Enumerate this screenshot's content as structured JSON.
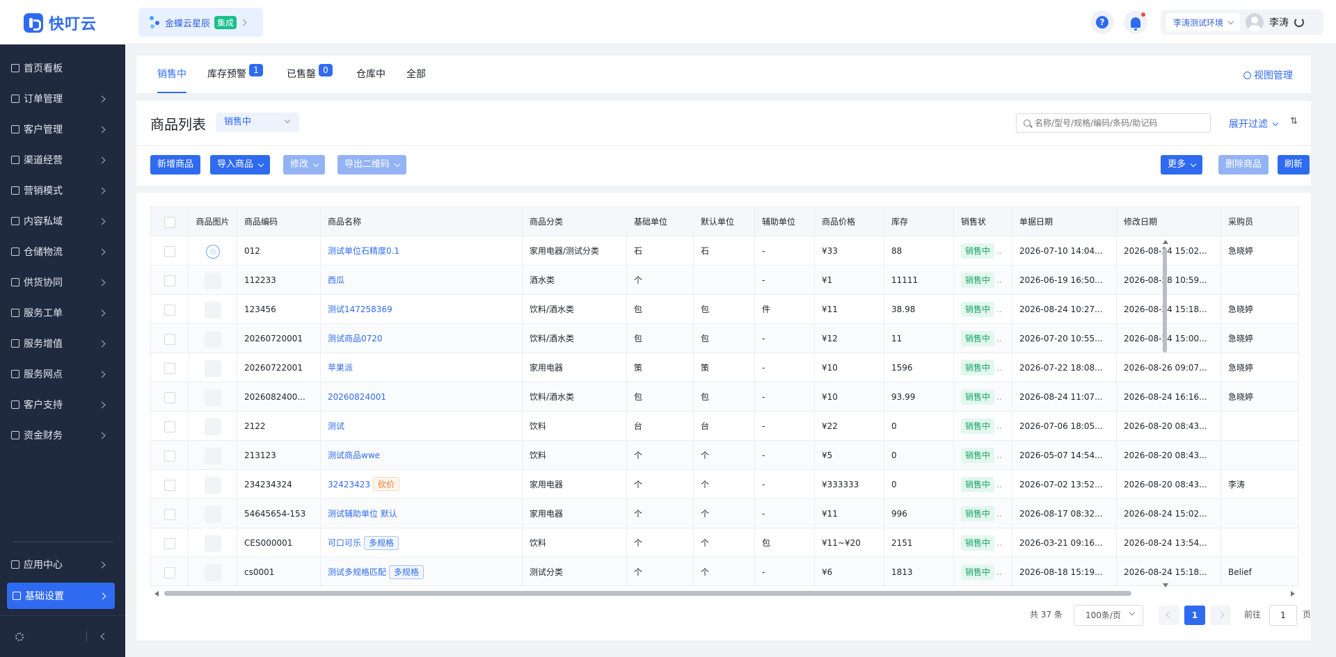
{
  "app": {
    "logo_text": "快叮云"
  },
  "header": {
    "app_switch": {
      "name": "金蝶云星辰",
      "tag": "集成"
    },
    "env": "李涛测试环境",
    "user_name": "李涛",
    "icons": [
      "help-icon",
      "bell-icon",
      "refresh-icon"
    ]
  },
  "sidebar": {
    "items": [
      {
        "label": "首页看板",
        "icon": "home-icon"
      },
      {
        "label": "订单管理",
        "icon": "order-icon"
      },
      {
        "label": "客户管理",
        "icon": "user-icon"
      },
      {
        "label": "渠道经营",
        "icon": "channel-icon"
      },
      {
        "label": "营销模式",
        "icon": "tag-icon"
      },
      {
        "label": "内容私域",
        "icon": "image-icon"
      },
      {
        "label": "仓储物流",
        "icon": "warehouse-icon"
      },
      {
        "label": "供货协同",
        "icon": "supply-icon"
      },
      {
        "label": "服务工单",
        "icon": "ticket-icon"
      },
      {
        "label": "服务增值",
        "icon": "bag-icon"
      },
      {
        "label": "服务网点",
        "icon": "store-icon"
      },
      {
        "label": "客户支持",
        "icon": "support-icon"
      },
      {
        "label": "资金财务",
        "icon": "yen-icon"
      }
    ],
    "bottom_items": [
      {
        "label": "应用中心",
        "icon": "app-icon"
      },
      {
        "label": "基础设置",
        "icon": "settings-icon",
        "active": true
      }
    ]
  },
  "tabs": [
    {
      "label": "销售中",
      "active": true
    },
    {
      "label": "库存预警",
      "badge": "1"
    },
    {
      "label": "已售罄",
      "badge": "0"
    },
    {
      "label": "仓库中"
    },
    {
      "label": "全部"
    }
  ],
  "view_manage": "视图管理",
  "list": {
    "title": "商品列表",
    "status_select": "销售中",
    "search_placeholder": "名称/型号/规格/编码/条码/助记码",
    "filter_label": "展开过滤",
    "sort_icon": "⇅"
  },
  "toolbar": {
    "add": "新增商品",
    "import": "导入商品",
    "edit": "修改",
    "export_qr": "导出二维码",
    "more": "更多",
    "delete": "删除商品",
    "refresh": "刷新"
  },
  "table": {
    "columns": [
      "商品图片",
      "商品编码",
      "商品名称",
      "商品分类",
      "基础单位",
      "默认单位",
      "辅助单位",
      "商品价格",
      "库存",
      "销售状",
      "单据日期",
      "修改日期",
      "采购员"
    ],
    "rows": [
      {
        "code": "012",
        "name": "测试单位石精度0.1",
        "tag": "",
        "category": "家用电器/测试分类",
        "base_unit": "石",
        "default_unit": "石",
        "aux_unit": "-",
        "price": "¥33",
        "stock": "88",
        "status": "销售中",
        "doc_date": "2026-07-10 14:04...",
        "mod_date": "2026-08-24 15:02...",
        "buyer": "急晓婷",
        "has_image": true
      },
      {
        "code": "112233",
        "name": "西瓜",
        "tag": "",
        "category": "酒水类",
        "base_unit": "个",
        "default_unit": "",
        "aux_unit": "-",
        "price": "¥1",
        "stock": "11111",
        "status": "销售中",
        "doc_date": "2026-06-19 16:50...",
        "mod_date": "2026-08-28 10:59...",
        "buyer": ""
      },
      {
        "code": "123456",
        "name": "测试147258369",
        "tag": "",
        "category": "饮料/酒水类",
        "base_unit": "包",
        "default_unit": "包",
        "aux_unit": "件",
        "price": "¥11",
        "stock": "38.98",
        "status": "销售中",
        "doc_date": "2026-08-24 10:27...",
        "mod_date": "2026-08-24 15:18...",
        "buyer": "急晓婷"
      },
      {
        "code": "20260720001",
        "name": "测试商品0720",
        "tag": "",
        "category": "饮料/酒水类",
        "base_unit": "包",
        "default_unit": "包",
        "aux_unit": "-",
        "price": "¥12",
        "stock": "11",
        "status": "销售中",
        "doc_date": "2026-07-20 10:55...",
        "mod_date": "2026-08-24 15:00...",
        "buyer": "急晓婷"
      },
      {
        "code": "20260722001",
        "name": "苹果派",
        "tag": "",
        "category": "家用电器",
        "base_unit": "策",
        "default_unit": "策",
        "aux_unit": "-",
        "price": "¥10",
        "stock": "1596",
        "status": "销售中",
        "doc_date": "2026-07-22 18:08...",
        "mod_date": "2026-08-26 09:07...",
        "buyer": "急晓婷"
      },
      {
        "code": "2026082400...",
        "name": "20260824001",
        "tag": "",
        "category": "饮料/酒水类",
        "base_unit": "包",
        "default_unit": "包",
        "aux_unit": "-",
        "price": "¥10",
        "stock": "93.99",
        "status": "销售中",
        "doc_date": "2026-08-24 11:07...",
        "mod_date": "2026-08-24 16:16...",
        "buyer": "急晓婷"
      },
      {
        "code": "2122",
        "name": "测试",
        "tag": "",
        "category": "饮料",
        "base_unit": "台",
        "default_unit": "台",
        "aux_unit": "-",
        "price": "¥22",
        "stock": "0",
        "status": "销售中",
        "doc_date": "2026-07-06 18:05...",
        "mod_date": "2026-08-20 08:43...",
        "buyer": ""
      },
      {
        "code": "213123",
        "name": "测试商品wwe",
        "tag": "",
        "category": "饮料",
        "base_unit": "个",
        "default_unit": "个",
        "aux_unit": "-",
        "price": "¥5",
        "stock": "0",
        "status": "销售中",
        "doc_date": "2026-05-07 14:54...",
        "mod_date": "2026-08-20 08:43...",
        "buyer": ""
      },
      {
        "code": "234234324",
        "name": "32423423",
        "tag": "砍价",
        "tag_type": "orange",
        "category": "家用电器",
        "base_unit": "个",
        "default_unit": "个",
        "aux_unit": "-",
        "price": "¥333333",
        "stock": "0",
        "status": "销售中",
        "doc_date": "2026-07-02 13:52...",
        "mod_date": "2026-08-20 08:43...",
        "buyer": "李涛"
      },
      {
        "code": "54645654-153",
        "name": "测试辅助单位 默认",
        "tag": "",
        "category": "家用电器",
        "base_unit": "个",
        "default_unit": "个",
        "aux_unit": "-",
        "price": "¥11",
        "stock": "996",
        "status": "销售中",
        "doc_date": "2026-08-17 08:32...",
        "mod_date": "2026-08-24 15:02...",
        "buyer": ""
      },
      {
        "code": "CES000001",
        "name": "可口可乐",
        "tag": "多规格",
        "tag_type": "blue",
        "category": "饮料",
        "base_unit": "个",
        "default_unit": "个",
        "aux_unit": "包",
        "price": "¥11~¥20",
        "stock": "2151",
        "status": "销售中",
        "doc_date": "2026-03-21 09:16...",
        "mod_date": "2026-08-24 13:54...",
        "buyer": ""
      },
      {
        "code": "cs0001",
        "name": "测试多规格匹配",
        "tag": "多规格",
        "tag_type": "blue",
        "category": "测试分类",
        "base_unit": "个",
        "default_unit": "个",
        "aux_unit": "-",
        "price": "¥6",
        "stock": "1813",
        "status": "销售中",
        "doc_date": "2026-08-18 15:19...",
        "mod_date": "2026-08-24 15:18...",
        "buyer": "Belief"
      }
    ]
  },
  "pagination": {
    "total": "共 37 条",
    "page_size": "100条/页",
    "current_page": "1",
    "goto_label": "前往",
    "goto_value": "1",
    "page_unit": "页"
  }
}
